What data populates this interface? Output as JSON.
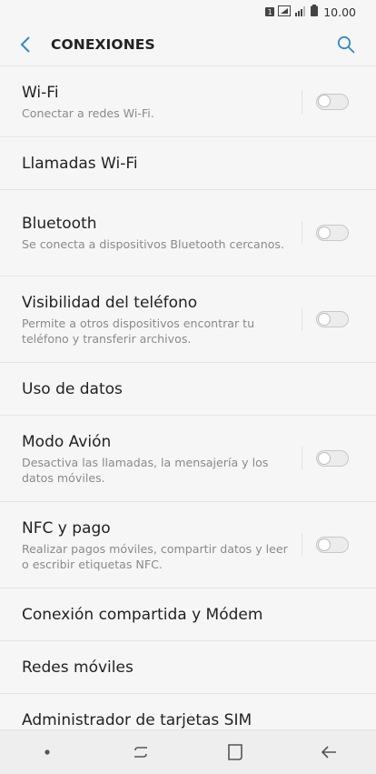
{
  "status_bar": {
    "sim_slot": "1",
    "time": "10.00",
    "icons": [
      "sim-icon",
      "signal-icon",
      "signal-bars-icon",
      "battery-icon"
    ]
  },
  "header": {
    "title": "CONEXIONES",
    "back_icon": "back-chevron-icon",
    "search_icon": "search-icon",
    "accent_color": "#2e8bc9"
  },
  "items": [
    {
      "title": "Wi-Fi",
      "subtitle": "Conectar a redes Wi-Fi.",
      "toggle": "off"
    },
    {
      "title": "Llamadas Wi-Fi"
    },
    {
      "title": "Bluetooth",
      "subtitle": "Se conecta a dispositivos Bluetooth cercanos.",
      "toggle": "off"
    },
    {
      "title": "Visibilidad del teléfono",
      "subtitle": "Permite a otros dispositivos encontrar tu teléfono y transferir archivos.",
      "toggle": "off"
    },
    {
      "title": "Uso de datos"
    },
    {
      "title": "Modo Avión",
      "subtitle": "Desactiva las llamadas, la mensajería y los datos móviles.",
      "toggle": "off"
    },
    {
      "title": "NFC y pago",
      "subtitle": "Realizar pagos móviles, compartir datos y leer o escribir etiquetas NFC.",
      "toggle": "off"
    },
    {
      "title": "Conexión compartida y Módem"
    },
    {
      "title": "Redes móviles"
    },
    {
      "title": "Administrador de tarjetas SIM"
    }
  ],
  "nav_bar": {
    "icons": [
      "dot-icon",
      "recent-apps-icon",
      "home-icon",
      "back-arrow-icon"
    ]
  }
}
